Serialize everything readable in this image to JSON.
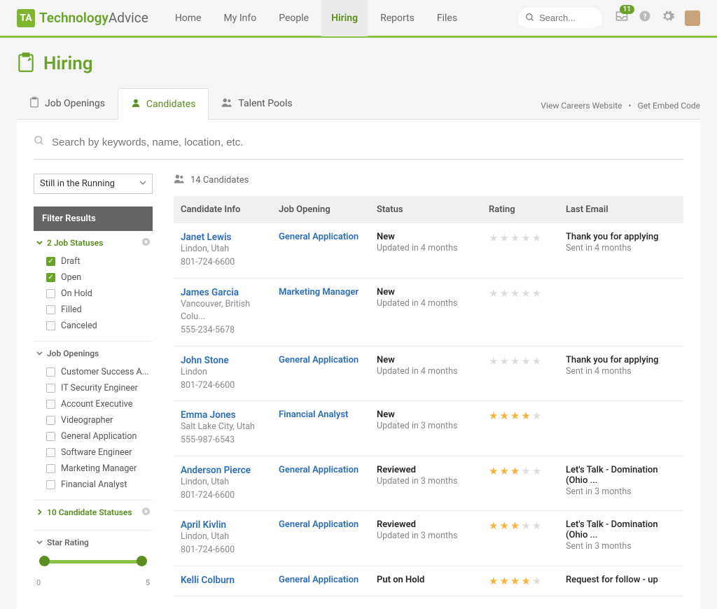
{
  "brand": {
    "markText": "TA",
    "text1": "Technology",
    "text2": "Advice"
  },
  "nav": {
    "items": [
      "Home",
      "My Info",
      "People",
      "Hiring",
      "Reports",
      "Files"
    ],
    "activeIndex": 3
  },
  "search": {
    "placeholder": "Search..."
  },
  "notifications": {
    "count": "11"
  },
  "page": {
    "title": "Hiring"
  },
  "tabs": {
    "items": [
      {
        "label": "Job Openings",
        "icon": "clipboard"
      },
      {
        "label": "Candidates",
        "icon": "person"
      },
      {
        "label": "Talent Pools",
        "icon": "people"
      }
    ],
    "activeIndex": 1,
    "links": {
      "careers": "View Careers Website",
      "embed": "Get Embed Code"
    }
  },
  "keywordSearch": {
    "placeholder": "Search by keywords, name, location, etc."
  },
  "filterSelect": {
    "value": "Still in the Running"
  },
  "filterHeader": "Filter Results",
  "filters": {
    "jobStatuses": {
      "title": "2 Job Statuses",
      "items": [
        {
          "label": "Draft",
          "checked": true
        },
        {
          "label": "Open",
          "checked": true
        },
        {
          "label": "On Hold",
          "checked": false
        },
        {
          "label": "Filled",
          "checked": false
        },
        {
          "label": "Canceled",
          "checked": false
        }
      ]
    },
    "jobOpenings": {
      "title": "Job Openings",
      "items": [
        {
          "label": "Customer Success A...",
          "checked": false
        },
        {
          "label": "IT Security Engineer",
          "checked": false
        },
        {
          "label": "Account Executive",
          "checked": false
        },
        {
          "label": "Videographer",
          "checked": false
        },
        {
          "label": "General Application",
          "checked": false
        },
        {
          "label": "Software Engineer",
          "checked": false
        },
        {
          "label": "Marketing Manager",
          "checked": false
        },
        {
          "label": "Financial Analyst",
          "checked": false
        }
      ]
    },
    "candidateStatuses": {
      "title": "10 Candidate Statuses"
    },
    "starRating": {
      "title": "Star Rating",
      "min": "0",
      "max": "5"
    }
  },
  "countLabel": "14 Candidates",
  "columns": {
    "c1": "Candidate Info",
    "c2": "Job Opening",
    "c3": "Status",
    "c4": "Rating",
    "c5": "Last Email"
  },
  "rows": [
    {
      "name": "Janet Lewis",
      "loc": "Lindon, Utah",
      "phone": "801-724-6600",
      "job": "General Application",
      "status": "New",
      "statusSub": "Updated in 4 months",
      "stars": 0,
      "emailSub": "Thank you for applying",
      "emailSent": "Sent in 4 months"
    },
    {
      "name": "James Garcia",
      "loc": "Vancouver, British Colu...",
      "phone": "555-234-5678",
      "job": "Marketing Manager",
      "status": "New",
      "statusSub": "Updated in 4 months",
      "stars": 0,
      "emailSub": "",
      "emailSent": ""
    },
    {
      "name": "John Stone",
      "loc": "Lindon",
      "phone": "801-724-6600",
      "job": "General Application",
      "status": "New",
      "statusSub": "Updated in 4 months",
      "stars": 0,
      "emailSub": "Thank you for applying",
      "emailSent": "Sent in 4 months"
    },
    {
      "name": "Emma Jones",
      "loc": "Salt Lake City, Utah",
      "phone": "555-987-6543",
      "job": "Financial Analyst",
      "status": "New",
      "statusSub": "Updated in 3 months",
      "stars": 4,
      "emailSub": "",
      "emailSent": ""
    },
    {
      "name": "Anderson Pierce",
      "loc": "Lindon, Utah",
      "phone": "801-724-6600",
      "job": "General Application",
      "status": "Reviewed",
      "statusSub": "Updated in 3 months",
      "stars": 3,
      "emailSub": "Let's Talk - Domination (Ohio ...",
      "emailSent": "Sent in 3 months"
    },
    {
      "name": "April Kivlin",
      "loc": "Lindon, Utah",
      "phone": "801-724-6600",
      "job": "General Application",
      "status": "Reviewed",
      "statusSub": "Updated in 3 months",
      "stars": 3,
      "emailSub": "Let's Talk - Domination (Ohio ...",
      "emailSent": "Sent in 3 months"
    },
    {
      "name": "Kelli Colburn",
      "loc": "",
      "phone": "",
      "job": "General Application",
      "status": "Put on Hold",
      "statusSub": "",
      "stars": 4,
      "emailSub": "Request for follow - up",
      "emailSent": ""
    }
  ]
}
